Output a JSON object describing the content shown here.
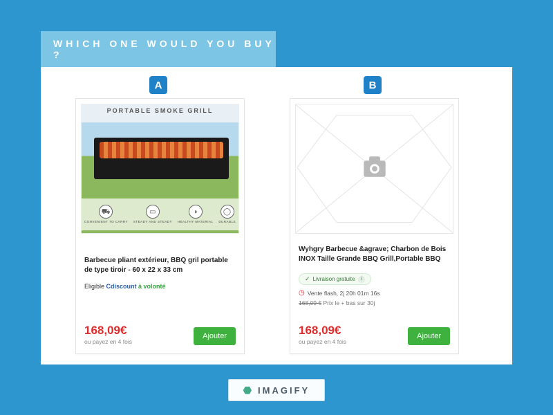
{
  "header": {
    "title": "WHICH ONE WOULD YOU BUY ?"
  },
  "badges": {
    "a": "A",
    "b": "B"
  },
  "card_a": {
    "image_banner": "PORTABLE SMOKE GRILL",
    "features": [
      {
        "icon": "⛟",
        "label": "CONVENIENT\nTO CARRY"
      },
      {
        "icon": "▭",
        "label": "STEADY\nAND STEADY"
      },
      {
        "icon": "◑",
        "label": "HEALTHY\nMATERIAL"
      },
      {
        "icon": "◯",
        "label": "DURABLE"
      }
    ],
    "title": "Barbecue pliant extérieur, BBQ gril portable de type tiroir - 60 x 22 x 33 cm",
    "eligible_prefix": "Eligible ",
    "eligible_brand": "Cdiscount",
    "eligible_suffix": " à volonté",
    "price": "168,09€",
    "pay4": "ou payez en 4 fois",
    "add_label": "Ajouter"
  },
  "card_b": {
    "title": "Wyhgry Barbecue &agrave; Charbon de Bois INOX Taille Grande BBQ Grill,Portable BBQ",
    "shipping": "Livraison gratuite",
    "flash": "Vente flash, 2j 20h 01m 16s",
    "old_price": "168,09 €",
    "low_price_text": " Prix le + bas sur 30j",
    "price": "168,09€",
    "pay4": "ou payez en 4 fois",
    "add_label": "Ajouter"
  },
  "footer": {
    "brand": "IMAGIFY"
  }
}
